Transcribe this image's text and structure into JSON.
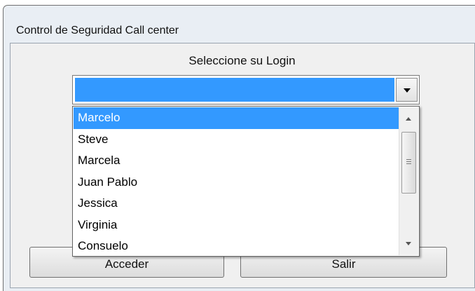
{
  "window": {
    "title": "Control de Seguridad Call center"
  },
  "login": {
    "prompt": "Seleccione su Login",
    "selected_value": "",
    "options": [
      "Marcelo",
      "Steve",
      "Marcela",
      "Juan Pablo",
      "Jessica",
      "Virginia",
      "Consuelo"
    ],
    "highlighted_option": "Marcelo"
  },
  "buttons": {
    "access_label": "Acceder",
    "exit_label": "Salir"
  },
  "icons": {
    "combo_arrow": "chevron-down-icon",
    "scroll_up": "scroll-up-icon",
    "scroll_down": "scroll-down-icon"
  },
  "colors": {
    "selection": "#3399ff",
    "dialog_bg": "#f0f0f0",
    "frame_bg": "#e9eef4"
  }
}
